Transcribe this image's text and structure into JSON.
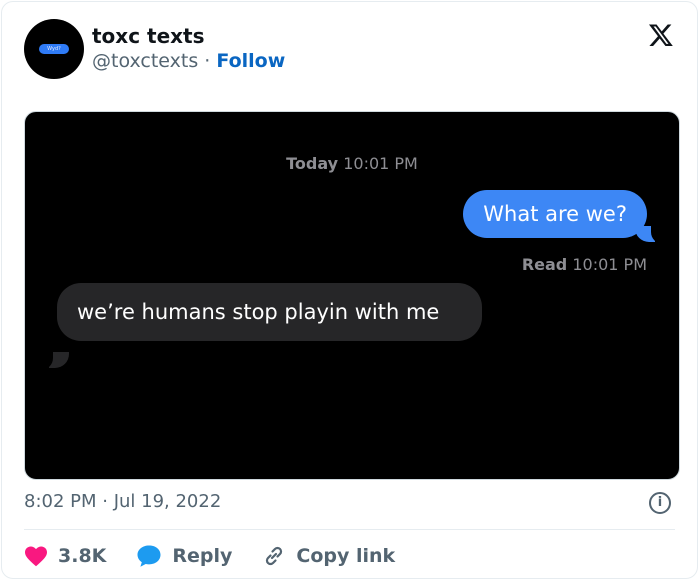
{
  "tweet": {
    "author_name": "toxc texts",
    "handle": "@toxctexts",
    "separator": "·",
    "follow_label": "Follow",
    "avatar_text": "Wyd?",
    "timestamp": "8:02 PM · Jul 19, 2022",
    "info_glyph": "i"
  },
  "screenshot": {
    "day_label": "Today",
    "day_time": "10:01 PM",
    "outgoing_message": "What are we?",
    "read_label": "Read",
    "read_time": "10:01 PM",
    "incoming_message": "we’re humans stop playin with me"
  },
  "actions": {
    "like_count": "3.8K",
    "reply_label": "Reply",
    "copy_link_label": "Copy link"
  },
  "colors": {
    "like": "#f91880",
    "reply": "#1d9bf0",
    "link": "#536471",
    "follow": "#0a66c2",
    "imessage_blue": "#3d87f5"
  }
}
